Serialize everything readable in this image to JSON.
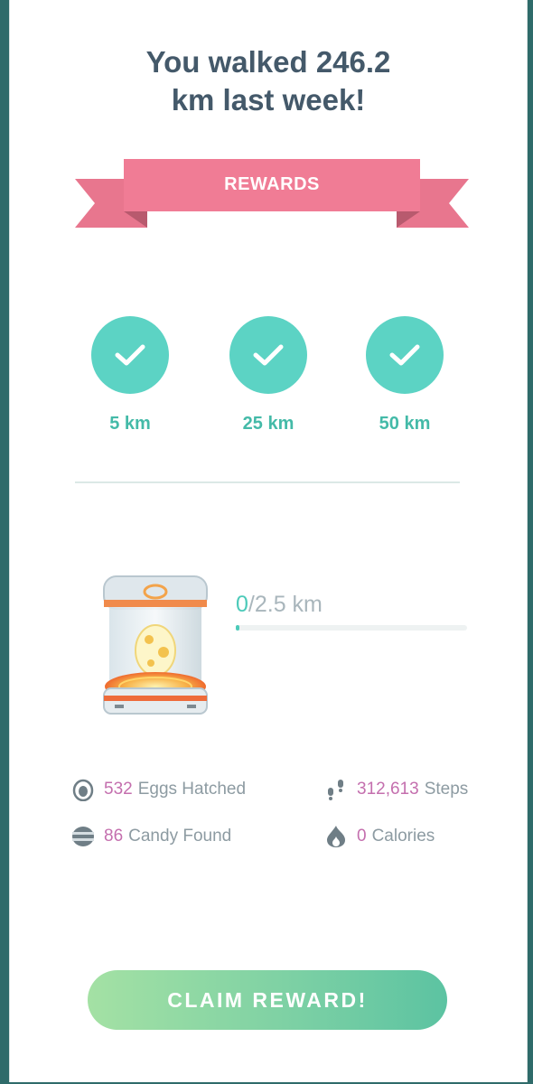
{
  "header": {
    "line1": "You walked 246.2",
    "line2": "km last week!"
  },
  "rewards_banner": {
    "label": "REWARDS"
  },
  "milestones": [
    {
      "label": "5 km",
      "completed": true
    },
    {
      "label": "25 km",
      "completed": true
    },
    {
      "label": "50 km",
      "completed": true
    }
  ],
  "incubator": {
    "current": "0",
    "total": "/2.5 km",
    "progress": 0
  },
  "stats": {
    "eggs": {
      "value": "532",
      "label": "Eggs Hatched",
      "icon": "egg-icon"
    },
    "steps": {
      "value": "312,613",
      "label": "Steps",
      "icon": "footprints-icon"
    },
    "candy": {
      "value": "86",
      "label": "Candy Found",
      "icon": "candy-icon"
    },
    "calories": {
      "value": "0",
      "label": "Calories",
      "icon": "flame-icon"
    }
  },
  "claim_button": {
    "label": "CLAIM REWARD!"
  },
  "colors": {
    "accent_teal": "#5cd3c4",
    "ribbon_pink": "#ef7a93",
    "stat_value_pink": "#c46fae",
    "button_green": "#7ed1a4"
  }
}
